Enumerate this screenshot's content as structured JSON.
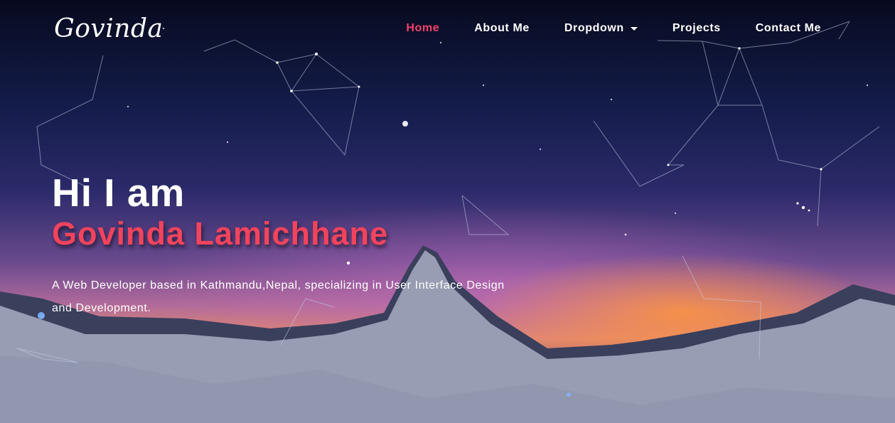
{
  "brand": {
    "name": "Govinda"
  },
  "nav": {
    "items": [
      {
        "label": "Home",
        "active": true
      },
      {
        "label": "About Me",
        "active": false
      },
      {
        "label": "Dropdown",
        "active": false,
        "has_caret": true
      },
      {
        "label": "Projects",
        "active": false
      },
      {
        "label": "Contact Me",
        "active": false
      }
    ]
  },
  "hero": {
    "greeting": "Hi I am",
    "name": "Govinda Lamichhane",
    "tagline": "A Web Developer based in Kathmandu,Nepal, specializing in User Interface Design and Development."
  },
  "colors": {
    "accent": "#f4435c",
    "active_nav": "#f2426a",
    "text": "#ffffff"
  },
  "icons": {
    "dropdown_caret": "caret-down-icon"
  }
}
